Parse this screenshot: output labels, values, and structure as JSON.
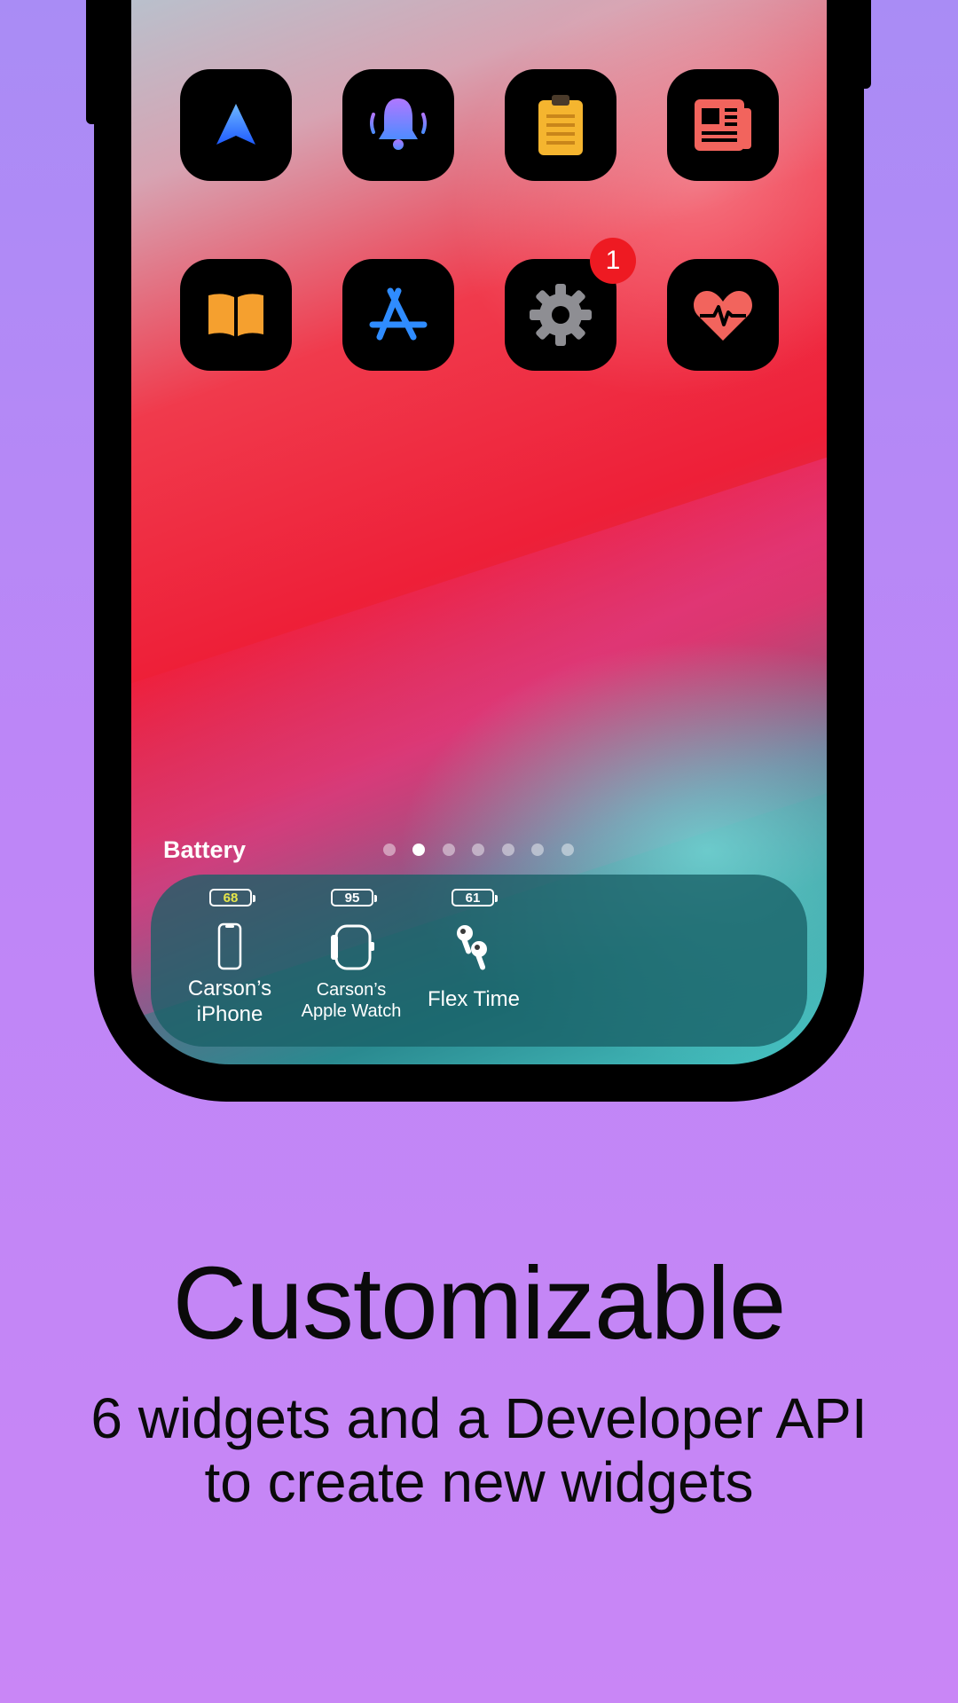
{
  "home_screen": {
    "apps": [
      {
        "name": "navigation-app",
        "icon": "location-arrow-icon"
      },
      {
        "name": "notifications-app",
        "icon": "bell-icon"
      },
      {
        "name": "clipboard-app",
        "icon": "clipboard-icon"
      },
      {
        "name": "news-app",
        "icon": "newspaper-icon"
      },
      {
        "name": "books-app",
        "icon": "book-icon"
      },
      {
        "name": "app-store-app",
        "icon": "app-store-icon"
      },
      {
        "name": "settings-app",
        "icon": "gear-icon",
        "badge": "1"
      },
      {
        "name": "health-app",
        "icon": "heart-pulse-icon"
      }
    ]
  },
  "widget": {
    "title": "Battery",
    "page_count": 7,
    "active_page": 1,
    "devices": [
      {
        "battery": "68",
        "icon": "iphone-icon",
        "label_line1": "Carson’s",
        "label_line2": "iPhone",
        "battery_color": "#e6e64a"
      },
      {
        "battery": "95",
        "icon": "apple-watch-icon",
        "label_line1": "Carson’s",
        "label_line2": "Apple Watch"
      },
      {
        "battery": "61",
        "icon": "airpods-icon",
        "label_line1": "Flex Time",
        "label_line2": ""
      }
    ]
  },
  "marketing": {
    "headline": "Customizable",
    "subtitle_line1": "6 widgets and a Developer API",
    "subtitle_line2": "to create new widgets"
  },
  "colors": {
    "background_top": "#a98cf5",
    "background_bottom": "#c986f6",
    "badge": "#ee1a22"
  }
}
